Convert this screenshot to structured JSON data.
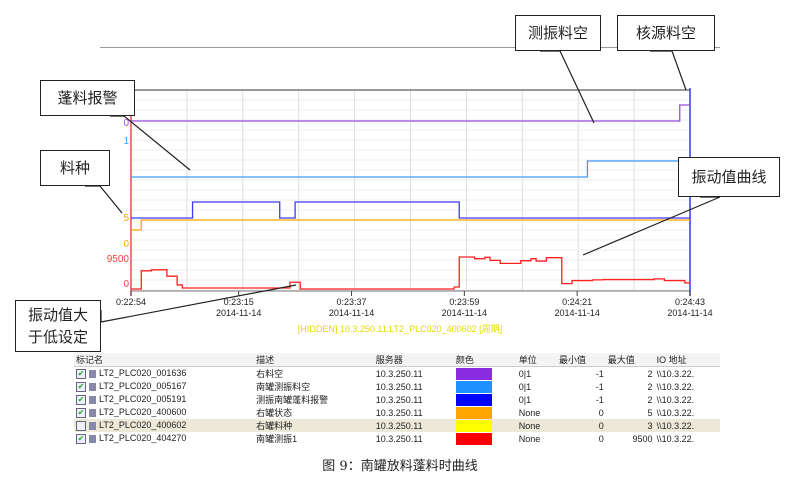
{
  "callouts": {
    "probe_empty": "测振料空",
    "nuclear_empty": "核源料空",
    "clog_alarm": "蓬料报警",
    "material_type": "料种",
    "vib_curve": "振动值曲线",
    "vib_over_low": "振动值大\n于低设定"
  },
  "axis_labels": {
    "purple_0": "0",
    "blue_1": "1",
    "orange_5": "5",
    "orange_0": "0",
    "red_9500": "9500",
    "red_0": "0"
  },
  "legend_line": "[HIDDEN] 10.3.250.11:LT2_PLC020_400602 [周期]",
  "chart_data": {
    "type": "line",
    "x_ticks": [
      {
        "time": "0:22:54",
        "date": ""
      },
      {
        "time": "0:23:15",
        "date": "2014-11-14"
      },
      {
        "time": "0:23:37",
        "date": "2014-11-14"
      },
      {
        "time": "0:23:59",
        "date": "2014-11-14"
      },
      {
        "time": "0:24:21",
        "date": "2014-11-14"
      },
      {
        "time": "0:24:43",
        "date": "2014-11-14"
      }
    ],
    "xlim": [
      "0:22:54",
      "0:24:43"
    ],
    "grid": true,
    "series": [
      {
        "name": "LT2_PLC020_001636",
        "color": "#9b4ee0",
        "ylim": [
          -1,
          2
        ],
        "points": [
          [
            "0:22:54",
            1
          ],
          [
            "0:24:41",
            2
          ],
          [
            "0:24:43",
            2
          ]
        ]
      },
      {
        "name": "LT2_PLC020_005167",
        "color": "#3d9bff",
        "ylim": [
          -1,
          2
        ],
        "points": [
          [
            "0:22:54",
            0
          ],
          [
            "0:24:23",
            1
          ],
          [
            "0:24:43",
            1
          ]
        ]
      },
      {
        "name": "LT2_PLC020_005191",
        "color": "#3b3bff",
        "ylim": [
          -1,
          2
        ],
        "points": [
          [
            "0:22:54",
            0
          ],
          [
            "0:23:06",
            1
          ],
          [
            "0:23:23",
            0
          ],
          [
            "0:23:26",
            1
          ],
          [
            "0:23:58",
            0
          ],
          [
            "0:24:43",
            0
          ]
        ]
      },
      {
        "name": "LT2_PLC020_400600",
        "color": "#ffa500",
        "ylim": [
          0,
          5
        ],
        "points": [
          [
            "0:22:54",
            3
          ],
          [
            "0:22:56",
            5
          ],
          [
            "0:24:43",
            5
          ]
        ]
      },
      {
        "name": "LT2_PLC020_404270",
        "color": "#ff2020",
        "ylim": [
          0,
          9500
        ],
        "points": [
          [
            "0:22:54",
            0
          ],
          [
            "0:22:56",
            5400
          ],
          [
            "0:22:58",
            5700
          ],
          [
            "0:23:01",
            3800
          ],
          [
            "0:23:03",
            1200
          ],
          [
            "0:23:04",
            300
          ],
          [
            "0:23:25",
            2000
          ],
          [
            "0:23:27",
            0
          ],
          [
            "0:23:57",
            600
          ],
          [
            "0:23:58",
            9500
          ],
          [
            "0:24:01",
            9000
          ],
          [
            "0:24:03",
            9400
          ],
          [
            "0:24:04",
            8500
          ],
          [
            "0:24:06",
            7600
          ],
          [
            "0:24:10",
            8400
          ],
          [
            "0:24:12",
            9000
          ],
          [
            "0:24:13",
            8300
          ],
          [
            "0:24:15",
            9300
          ],
          [
            "0:24:18",
            1600
          ],
          [
            "0:24:20",
            2500
          ],
          [
            "0:24:24",
            2700
          ],
          [
            "0:24:26",
            2800
          ],
          [
            "0:24:36",
            3000
          ],
          [
            "0:24:38",
            2500
          ],
          [
            "0:24:42",
            1800
          ],
          [
            "0:24:43",
            1800
          ]
        ]
      }
    ]
  },
  "table": {
    "headers": [
      "标记名",
      "描述",
      "服务器",
      "颜色",
      "单位",
      "最小值",
      "最大值",
      "IO 地址"
    ],
    "rows": [
      {
        "checked": true,
        "tag": "LT2_PLC020_001636",
        "desc": "右料空",
        "server": "10.3.250.11",
        "color": "#8a2be2",
        "unit": "0|1",
        "min": "-1",
        "max": "2",
        "io": "\\\\10.3.22."
      },
      {
        "checked": true,
        "tag": "LT2_PLC020_005167",
        "desc": "南罐测振料空",
        "server": "10.3.250.11",
        "color": "#1e90ff",
        "unit": "0|1",
        "min": "-1",
        "max": "2",
        "io": "\\\\10.3.22."
      },
      {
        "checked": true,
        "tag": "LT2_PLC020_005191",
        "desc": "测振南罐蓬料报警",
        "server": "10.3.250.11",
        "color": "#0000ff",
        "unit": "0|1",
        "min": "-1",
        "max": "2",
        "io": "\\\\10.3.22."
      },
      {
        "checked": true,
        "tag": "LT2_PLC020_400600",
        "desc": "右罐状态",
        "server": "10.3.250.11",
        "color": "#ffa500",
        "unit": "None",
        "min": "0",
        "max": "5",
        "io": "\\\\10.3.22."
      },
      {
        "checked": false,
        "tag": "LT2_PLC020_400602",
        "desc": "右罐料种",
        "server": "10.3.250.11",
        "color": "#ffff00",
        "unit": "None",
        "min": "0",
        "max": "3",
        "io": "\\\\10.3.22."
      },
      {
        "checked": true,
        "tag": "LT2_PLC020_404270",
        "desc": "南罐测振1",
        "server": "10.3.250.11",
        "color": "#ff0000",
        "unit": "None",
        "min": "0",
        "max": "9500",
        "io": "\\\\10.3.22."
      }
    ]
  },
  "caption": "图 9：南罐放料蓬料时曲线"
}
